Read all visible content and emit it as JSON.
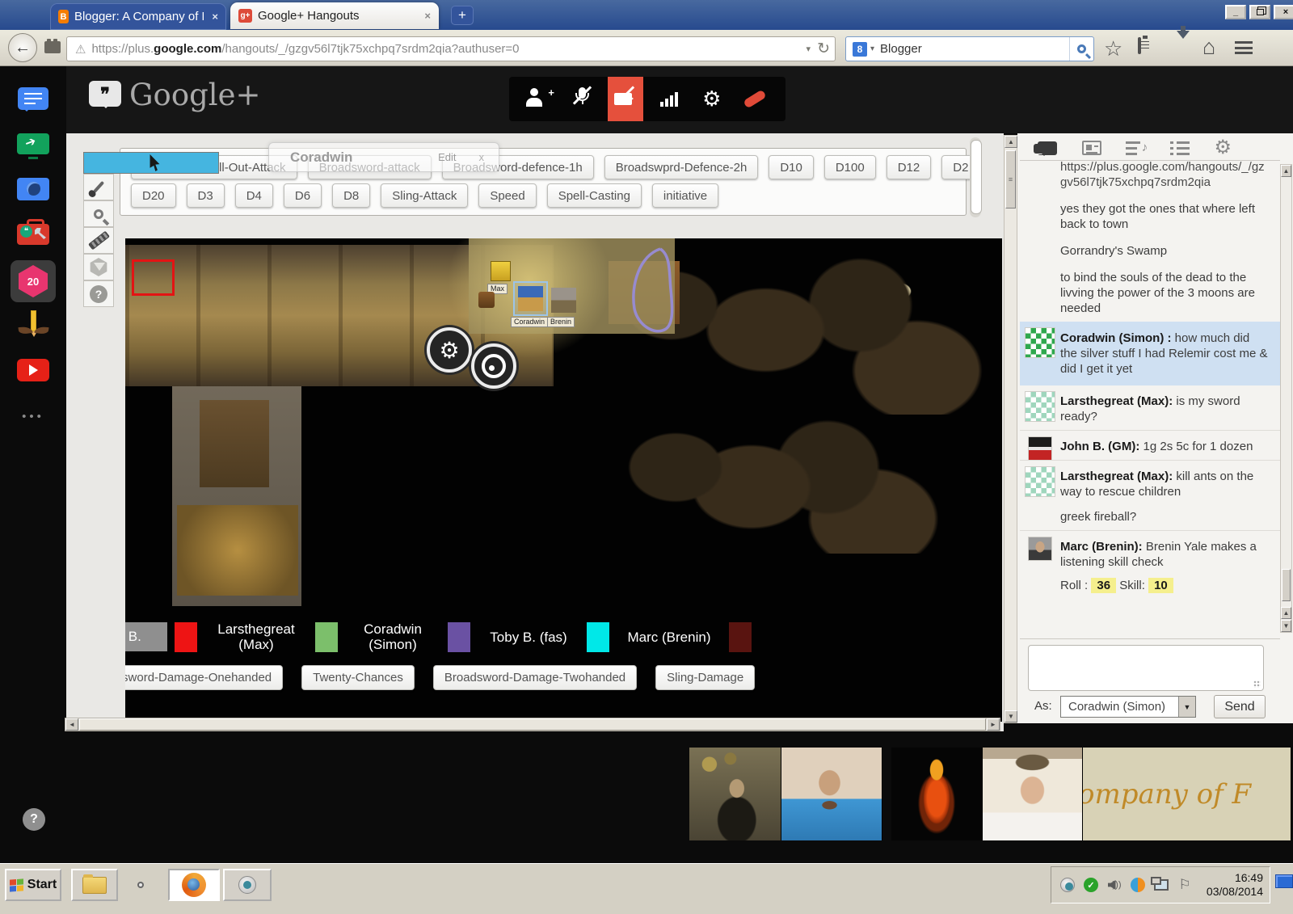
{
  "window": {
    "tabs": [
      {
        "title": "Blogger: A Company of Fools ...",
        "close_label": "×",
        "icon": "blogger-icon"
      },
      {
        "title": "Google+ Hangouts",
        "close_label": "×",
        "icon": "google-plus-icon"
      }
    ],
    "new_tab_label": "+",
    "control_icons": [
      "minimize-icon",
      "restore-icon",
      "close-icon"
    ],
    "minimize_label": "_",
    "close_label": "×"
  },
  "nav": {
    "back_icon": "←",
    "url_scheme": "https://plus.",
    "url_domain": "google.com",
    "url_path": "/hangouts/_/gzgv56l7tjk75xchpq7srdm2qia?authuser=0",
    "warning_icon": "⚠",
    "dropdown_icon": "▾",
    "reload_icon": "↻",
    "search_engine_label": "Blogger",
    "search_favicon_label": "8",
    "action_icons": [
      "bookmark-star-icon",
      "clipboard-icon",
      "download-icon",
      "home-icon",
      "menu-icon"
    ],
    "star_glyph": "☆",
    "home_glyph": "⌂"
  },
  "hangout": {
    "logo_text": "Google+",
    "logo_quote": "❞",
    "sidebar_apps": [
      "chat-app",
      "screenshare-app",
      "camera-app",
      "toolbox-app",
      "dice-roller-app",
      "draw-app",
      "youtube-app",
      "more-apps"
    ],
    "dice_app_label": "20",
    "more_dots": "•••",
    "help_label": "?",
    "call_controls": [
      "add-person",
      "mute-microphone",
      "mute-camera",
      "bandwidth",
      "settings",
      "hang-up"
    ],
    "settings_glyph": "⚙"
  },
  "macro_toolbar": {
    "row1": [
      "Broadsword-All-Out-Attack",
      "Broadsword-attack",
      "Broadsword-defence-1h",
      "Broadswprd-Defence-2h",
      "D10",
      "D100",
      "D12",
      "D2"
    ],
    "row2": [
      "D20",
      "D3",
      "D4",
      "D6",
      "D8",
      "Sling-Attack",
      "Speed",
      "Spell-Casting",
      "initiative"
    ]
  },
  "token_popup": {
    "title": "Coradwin",
    "edit_label": "Edit",
    "close_label": "x"
  },
  "tools": [
    "select-cursor",
    "paint-brush",
    "zoom",
    "ruler",
    "dice",
    "help"
  ],
  "map": {
    "tokens": [
      {
        "label": "Max"
      },
      {
        "label": "Coradwin"
      },
      {
        "label": "Brenin"
      }
    ],
    "selection_color": "#e31414",
    "drawing_color": "#978bd0",
    "overlay_buttons": [
      "map-settings",
      "webcam-view"
    ],
    "legend": [
      {
        "label": "John B.",
        "color": "#8f8f8f"
      },
      {
        "label": "Larsthegreat (Max)",
        "color": "#ee1414"
      },
      {
        "label": "Coradwin (Simon)",
        "color": "#7cbf6b"
      },
      {
        "label": "Toby B. (fas)",
        "color": "#6a51a3"
      },
      {
        "label": "Marc (Brenin)",
        "color": "#00e8e8"
      },
      {
        "label": "",
        "color": "#591410"
      }
    ],
    "bottom_buttons": [
      "Broadsword-Damage-Onehanded",
      "Twenty-Chances",
      "Broadsword-Damage-Twohanded",
      "Sling-Damage"
    ]
  },
  "chat": {
    "tab_icons": [
      "chat-icon",
      "notes-icon",
      "playlist-icon",
      "list-icon",
      "settings-icon"
    ],
    "messages": [
      {
        "text": "https://plus.google.com/hangouts/_/gzgv56l7tjk75xchpq7srdm2qia"
      },
      {
        "text": "yes they got the ones that where left back to town"
      },
      {
        "text": "Gorrandry's Swamp"
      },
      {
        "text": "to bind the souls of the dead to the livving the power of the 3 moons are needed"
      },
      {
        "author": "Coradwin (Simon) :",
        "text": "how much did the silver stuff I had Relemir cost me & did I get it yet",
        "highlight": true,
        "avatar": "green-pattern"
      },
      {
        "author": "Larsthegreat (Max):",
        "text": "is my sword ready?",
        "avatar": "mint-pattern"
      },
      {
        "author": "John B. (GM):",
        "text": "1g 2s 5c for 1 dozen",
        "avatar": "crest"
      },
      {
        "author": "Larsthegreat (Max):",
        "text": "kill ants on the way to rescue children",
        "extra": "greek fireball?",
        "avatar": "mint-pattern"
      },
      {
        "author": "Marc (Brenin):",
        "text": "Brenin Yale makes a listening skill check",
        "avatar": "photo",
        "roll": {
          "roll_label": "Roll :",
          "roll_value": "36",
          "skill_label": "Skill:",
          "skill_value": "10"
        }
      }
    ],
    "as_label": "As:",
    "as_value": "Coradwin (Simon)",
    "send_label": "Send",
    "highlight_color": "#cfe0f2",
    "roll_badge_color": "#f5ef8d"
  },
  "filmstrip": {
    "videos": [
      "participant-video-1",
      "participant-video-2",
      "avatar-fire-warrior",
      "participant-video-hat",
      "banner"
    ],
    "banner_text": "ompany of F"
  },
  "taskbar": {
    "start_label": "Start",
    "quick_launch": [
      "explorer",
      "avast",
      "firefox",
      "webcam"
    ],
    "tray_icons": [
      "webcam-icon",
      "usb-icon",
      "volume-icon",
      "avast-icon",
      "network-icon",
      "flag-icon"
    ],
    "usb_check": "✓",
    "flag_glyph": "⚐",
    "clock_time": "16:49",
    "clock_date": "03/08/2014"
  }
}
